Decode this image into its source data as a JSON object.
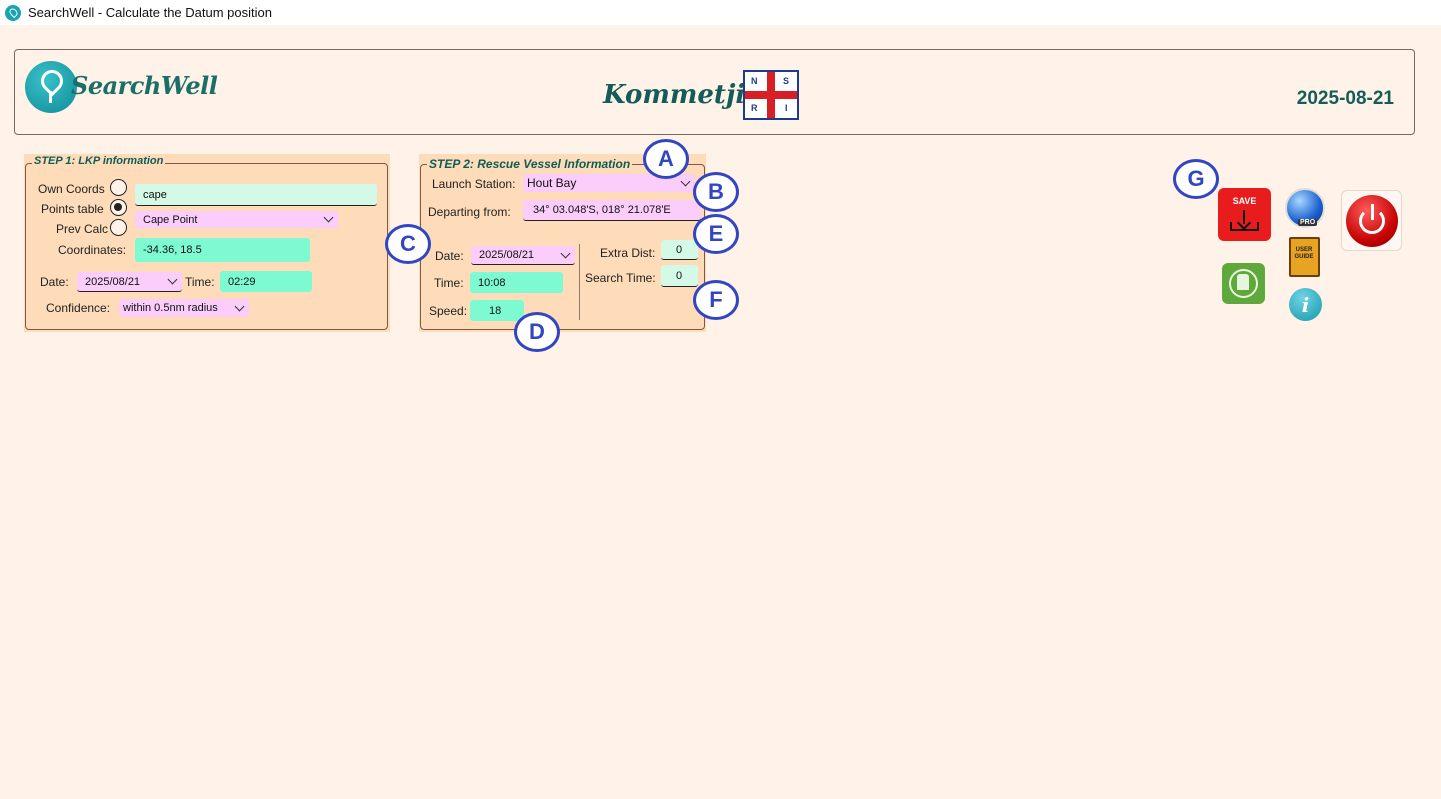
{
  "window": {
    "title": "SearchWell - Calculate the Datum position"
  },
  "header": {
    "logo_text": "SearchWell",
    "station": "Kommetjie",
    "flag_letters": [
      "N",
      "S",
      "R",
      "I"
    ],
    "date": "2025-08-21"
  },
  "step1": {
    "legend": "STEP 1: LKP information",
    "own_coords_label": "Own Coords",
    "points_table_label": "Points table",
    "prev_calc_label": "Prev Calc",
    "selected_source": "Points table",
    "search_value": "cape",
    "point_selected": "Cape Point",
    "coordinates_label": "Coordinates:",
    "coordinates_value": "-34.36,  18.5",
    "date_label": "Date:",
    "date_value": "2025/08/21",
    "time_label": "Time:",
    "time_value": "02:29",
    "confidence_label": "Confidence:",
    "confidence_value": "within 0.5nm radius"
  },
  "step2": {
    "legend": "STEP 2: Rescue Vessel Information",
    "launch_station_label": "Launch Station:",
    "launch_station_value": "Hout Bay",
    "departing_label": "Departing from:",
    "departing_value": "34° 03.048'S, 018° 21.078'E",
    "date_label": "Date:",
    "date_value": "2025/08/21",
    "time_label": "Time:",
    "time_value": "10:08",
    "speed_label": "Speed:",
    "speed_value": "18",
    "extra_dist_label": "Extra Dist:",
    "extra_dist_value": "0",
    "search_time_label": "Search Time:",
    "search_time_value": "0"
  },
  "callouts": {
    "a": "A",
    "b": "B",
    "c": "C",
    "d": "D",
    "e": "E",
    "f": "F",
    "g": "G"
  },
  "toolbar": {
    "save_label": "SAVE",
    "earth_badge": "PRO",
    "guide_label": "USER GUIDE",
    "info_glyph": "i"
  },
  "colors": {
    "background": "#fff2e8",
    "panel": "#fedcb9",
    "heading_teal": "#135c57",
    "field_mint": "#d4f9e6",
    "field_aqua": "#7dfad2",
    "field_pink": "#facdfb",
    "callout_blue": "#3346c2",
    "save_red": "#e81c1c"
  },
  "icons": [
    "app-pin-icon",
    "location-pin-icon",
    "nsri-flag-icon",
    "save-icon",
    "google-earth-pro-icon",
    "power-icon",
    "user-guide-icon",
    "clear-icon",
    "info-icon",
    "chevron-down-icon"
  ]
}
